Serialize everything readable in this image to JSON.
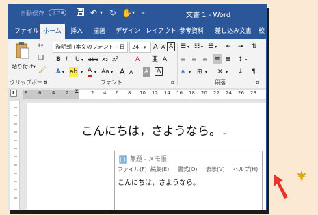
{
  "title_bar": {
    "autosave_label": "自動保存",
    "autosave_state": "オフ",
    "doc_title": "文書 1 - Word"
  },
  "tabs": [
    "ファイル",
    "ホーム",
    "挿入",
    "描画",
    "デザイン",
    "レイアウト",
    "参考資料",
    "差し込み文書",
    "校"
  ],
  "active_tab": "ホーム",
  "ribbon": {
    "paste_label": "貼り付け",
    "font_name": "游明朝 (本文のフォント - 日",
    "font_size": "24",
    "clipboard_group": "クリップボード",
    "font_group": "フォント",
    "paragraph_group": "段落",
    "bold": "B",
    "italic": "I",
    "underline": "U",
    "strikethrough": "abc",
    "subscript": "x₂",
    "superscript": "x²",
    "clear_format": "A",
    "text_effect": "A",
    "highlight": "ab",
    "font_color": "A",
    "change_case": "Aa",
    "grow_font": "A",
    "shrink_font": "A",
    "char_shade": "A",
    "char_border": "A",
    "ruby": "亜",
    "enclose": "A"
  },
  "ruler": {
    "ticks": [
      "8",
      "6",
      "4",
      "2",
      "",
      "2",
      "4",
      "6",
      "8",
      "10",
      "12",
      "14",
      "16",
      "18",
      "20",
      "22",
      "24",
      "26",
      "28"
    ],
    "tab_selector": "L"
  },
  "document": {
    "text": "こんにちは，さようなら。",
    "para_mark": "↵"
  },
  "notepad": {
    "title": "無題 - メモ帳",
    "menu": [
      "ファイル(F)",
      "編集(E)",
      "書式(O)",
      "表示(V)",
      "ヘルプ(H)"
    ],
    "content": "こんにちは，さようなら。"
  },
  "colors": {
    "word_blue": "#2b579a",
    "background": "#fce9d3",
    "arrow": "#e8322d"
  }
}
